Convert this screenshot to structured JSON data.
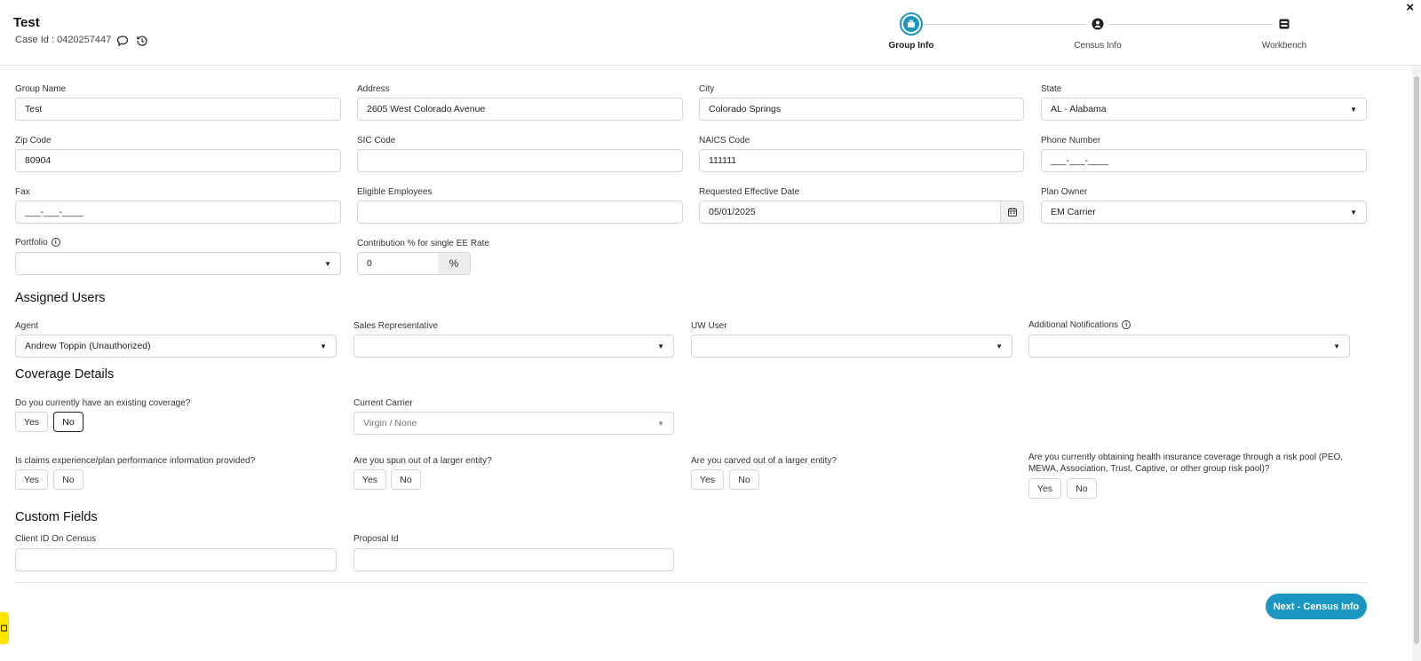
{
  "header": {
    "title": "Test",
    "case_id": "Case Id : 0420257447",
    "close_label": "×"
  },
  "stepper": {
    "steps": [
      {
        "label": "Group Info",
        "icon": "briefcase-icon",
        "active": true
      },
      {
        "label": "Census Info",
        "icon": "person-icon",
        "active": false
      },
      {
        "label": "Workbench",
        "icon": "workbench-icon",
        "active": false
      }
    ]
  },
  "group_info": {
    "group_name": {
      "label": "Group Name",
      "value": "Test"
    },
    "address": {
      "label": "Address",
      "value": "2605 West Colorado Avenue"
    },
    "city": {
      "label": "City",
      "value": "Colorado Springs"
    },
    "state": {
      "label": "State",
      "value": "AL - Alabama"
    },
    "zip": {
      "label": "Zip Code",
      "value": "80904"
    },
    "sic": {
      "label": "SIC Code",
      "value": ""
    },
    "naics": {
      "label": "NAICS Code",
      "value": "111111"
    },
    "phone": {
      "label": "Phone Number",
      "value": "___-___-____"
    },
    "fax": {
      "label": "Fax",
      "value": "___-___-____"
    },
    "eligible": {
      "label": "Eligible Employees",
      "value": ""
    },
    "effective_date": {
      "label": "Requested Effective Date",
      "value": "05/01/2025"
    },
    "plan_owner": {
      "label": "Plan Owner",
      "value": "EM Carrier"
    },
    "portfolio": {
      "label": "Portfolio",
      "value": ""
    },
    "contribution": {
      "label": "Contribution % for single EE Rate",
      "value": "0",
      "suffix": "%"
    }
  },
  "assigned_users": {
    "heading": "Assigned Users",
    "agent": {
      "label": "Agent",
      "value": "Andrew Toppin (Unauthorized)"
    },
    "sales_rep": {
      "label": "Sales Representative",
      "value": ""
    },
    "uw_user": {
      "label": "UW User",
      "value": ""
    },
    "additional": {
      "label": "Additional Notifications",
      "value": ""
    }
  },
  "coverage": {
    "heading": "Coverage Details",
    "existing": {
      "question": "Do you currently have an existing coverage?",
      "selected": "No"
    },
    "current_carrier": {
      "label": "Current Carrier",
      "value": "Virgin / None"
    },
    "claims": {
      "question": "Is claims experience/plan performance information provided?"
    },
    "spun": {
      "question": "Are you spun out of a larger entity?"
    },
    "carved": {
      "question": "Are you carved out of a larger entity?"
    },
    "risk_pool": {
      "question_line1": "Are you currently obtaining health insurance coverage through a risk pool (PEO,",
      "question_line2": "MEWA, Association, Trust, Captive, or other group risk pool)?"
    },
    "yes_label": "Yes",
    "no_label": "No"
  },
  "custom_fields": {
    "heading": "Custom Fields",
    "client_id": {
      "label": "Client ID On Census",
      "value": ""
    },
    "proposal_id": {
      "label": "Proposal Id",
      "value": ""
    }
  },
  "footer": {
    "next_label": "Next - Census Info"
  },
  "colors": {
    "accent": "#1b96c1",
    "feedback": "#ffe600"
  }
}
